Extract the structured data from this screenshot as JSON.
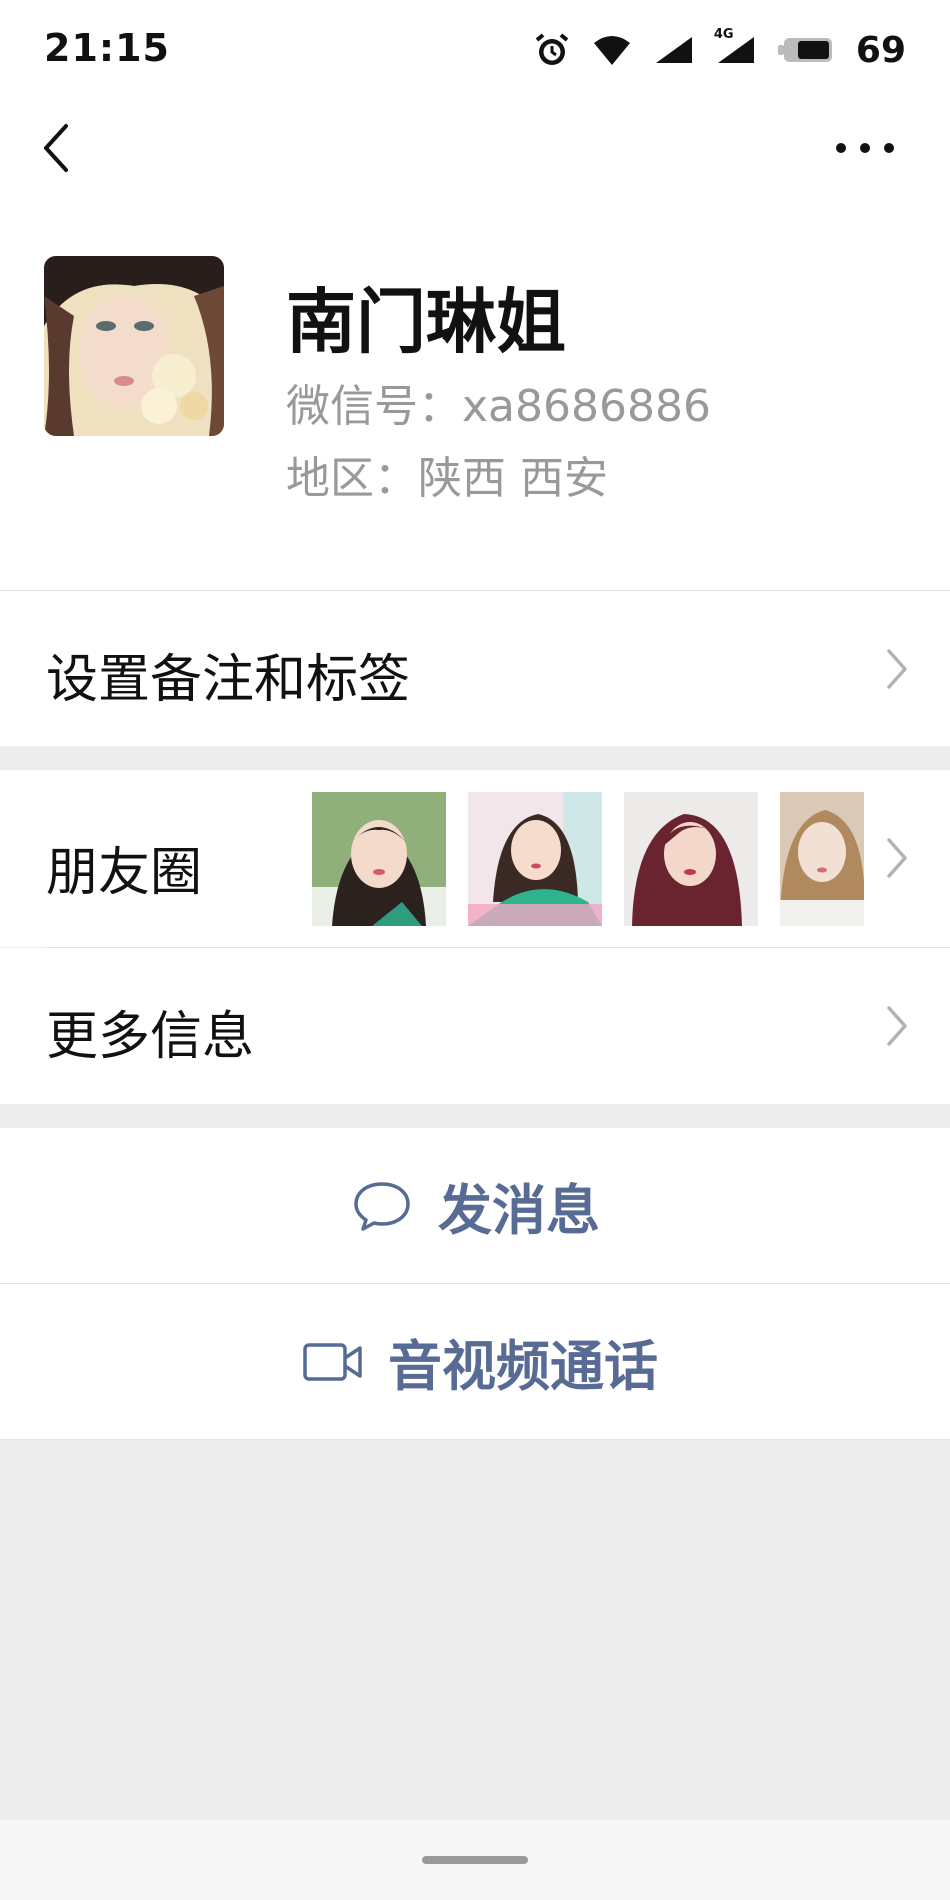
{
  "status_bar": {
    "time": "21:15",
    "network_label": "4G",
    "battery_percent": "69",
    "icons": [
      "alarm-icon",
      "wifi-icon",
      "signal-icon",
      "signal-4g-icon",
      "battery-icon"
    ]
  },
  "nav": {
    "back_icon": "chevron-left-icon",
    "more_icon": "more-dots-icon"
  },
  "profile": {
    "nickname": "南门琳姐",
    "wechat_id": "微信号：xa8686886",
    "region": "地区：陕西  西安"
  },
  "rows": {
    "remark_label": "设置备注和标签",
    "moments_label": "朋友圈",
    "more_info_label": "更多信息"
  },
  "actions": {
    "message_label": "发消息",
    "call_label": "音视频通话"
  },
  "colors": {
    "accent": "#576b95",
    "background": "#ededed"
  }
}
